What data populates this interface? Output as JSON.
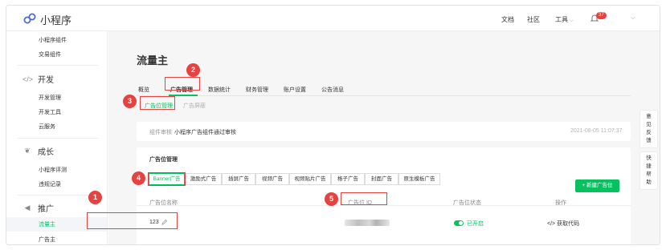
{
  "topbar": {
    "brand": "小程序",
    "links": [
      "文档",
      "社区",
      "工具"
    ],
    "tools_caret": "⌵",
    "badge": "37",
    "account_caret": "⌵"
  },
  "sidebar": {
    "items_top": [
      "小程序组件",
      "交易组件"
    ],
    "sections": [
      {
        "icon": "code-icon",
        "icon_glyph": "</>",
        "label": "开发",
        "items": [
          "开发管理",
          "开发工具",
          "云服务"
        ]
      },
      {
        "icon": "growth-icon",
        "icon_glyph": "❦",
        "label": "成长",
        "items": [
          "小程序评测",
          "违规记录"
        ]
      },
      {
        "icon": "megaphone-icon",
        "icon_glyph": "◀",
        "label": "推广",
        "items": [
          "流量主",
          "广告主"
        ]
      }
    ],
    "active_item": "流量主"
  },
  "main": {
    "page_title": "流量主",
    "tabs": [
      "概览",
      "广告管理",
      "数据统计",
      "财务管理",
      "账户设置",
      "公告消息"
    ],
    "active_tab": "广告管理",
    "subtabs": [
      "广告位管理",
      "广告屏蔽"
    ],
    "notice": {
      "label": "组件审核",
      "text": "小程序广告组件通过审核",
      "time": "2021-08-05 11:07:37"
    },
    "section_title": "广告位管理",
    "ad_types": [
      "Banner广告",
      "激励式广告",
      "插屏广告",
      "视频广告",
      "视频贴片广告",
      "格子广告",
      "封面广告",
      "原生模板广告"
    ],
    "new_button": "+ 新建广告位",
    "table_headers": [
      "广告位名称",
      "广告位 ID",
      "广告位状态",
      "操作"
    ],
    "row": {
      "name": "123",
      "status": "已开启",
      "action": "获取代码"
    }
  },
  "annotations": [
    "1",
    "2",
    "3",
    "4",
    "5"
  ],
  "feedback": [
    [
      "意",
      "见",
      "反",
      "馈"
    ],
    [
      "快",
      "捷",
      "帮",
      "助"
    ]
  ],
  "colors": {
    "accent": "#07c160",
    "highlight": "#e64340"
  }
}
